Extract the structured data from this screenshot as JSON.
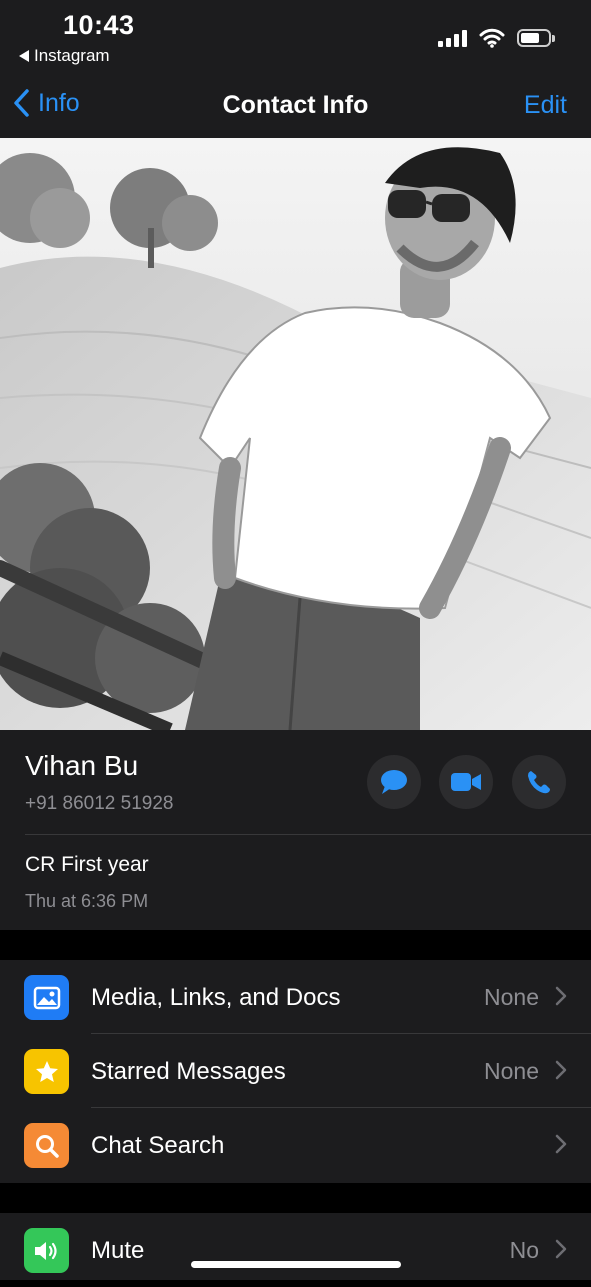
{
  "status_bar": {
    "time": "10:43",
    "back_app": "Instagram",
    "signal_icon": "cellular-signal-icon",
    "wifi_icon": "wifi-icon",
    "battery_icon": "battery-icon"
  },
  "nav": {
    "back_label": "Info",
    "title": "Contact Info",
    "edit_label": "Edit"
  },
  "contact": {
    "name": "Vihan Bu",
    "phone": "+91 86012 51928",
    "about": "CR First year",
    "about_date": "Thu at 6:36 PM",
    "actions": [
      "message-icon",
      "video-call-icon",
      "voice-call-icon"
    ]
  },
  "list_group_1": {
    "rows": [
      {
        "label": "Media, Links, and Docs",
        "value": "None",
        "icon": "photo-icon",
        "color": "#1f7cf5"
      },
      {
        "label": "Starred Messages",
        "value": "None",
        "icon": "star-icon",
        "color": "#f7c400"
      },
      {
        "label": "Chat Search",
        "value": "",
        "icon": "search-icon",
        "color": "#f58a35"
      }
    ]
  },
  "list_group_2": {
    "rows": [
      {
        "label": "Mute",
        "value": "No",
        "icon": "speaker-icon",
        "color": "#34c759"
      }
    ]
  },
  "colors": {
    "accent": "#2a91f5",
    "background": "#000000",
    "cell": "#1c1c1e",
    "secondary_text": "#8e8e93"
  }
}
